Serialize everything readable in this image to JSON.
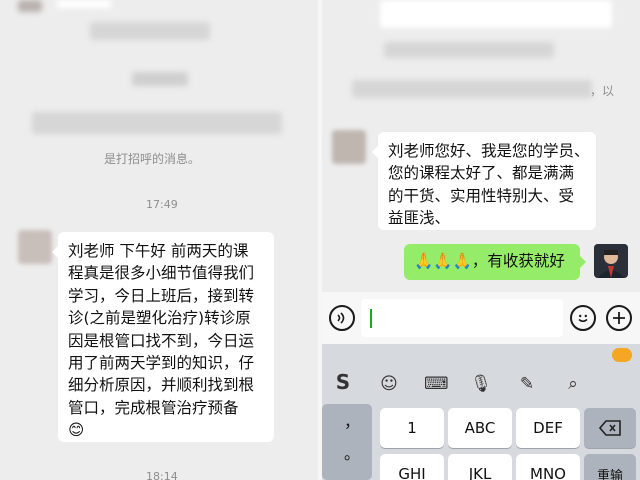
{
  "left": {
    "system_message": "是打招呼的消息。",
    "time_1": "17:49",
    "time_2": "18:14",
    "message": {
      "lines": [
        "刘老师 下午好 前两天的课",
        "程真是很多小细节值得我们",
        "学习，今日上班后，接到转",
        "诊(之前是塑化治疗)转诊原",
        "因是根管口找不到，今日运",
        "用了前两天学到的知识，仔",
        "细分析原因，并顺利找到根",
        "管口，完成根管治疗预备"
      ],
      "emoji": "😊"
    }
  },
  "right": {
    "partial_text": "，以",
    "message": {
      "lines": [
        "刘老师您好、我是您的学员、",
        "您的课程太好了、都是满满",
        "的干货、实用性特别大、受",
        "益匪浅、"
      ]
    },
    "reply": {
      "emoji": "🙏🙏🙏",
      "text": "，有收获就好"
    },
    "keyboard": {
      "row1": [
        "1",
        "ABC",
        "DEF"
      ],
      "row2": [
        "GHI",
        "JKL",
        "MNO"
      ],
      "side_symbols": [
        "，",
        "。"
      ],
      "backspace_icon": "backspace-icon",
      "newline_label": "重输"
    },
    "toolbar_icons": [
      "sogou-logo",
      "emoji-icon",
      "keyboard-icon",
      "mic-icon",
      "pen-icon",
      "search-icon"
    ],
    "accent_color": "#1aad19",
    "bubble_green": "#95ec69"
  }
}
